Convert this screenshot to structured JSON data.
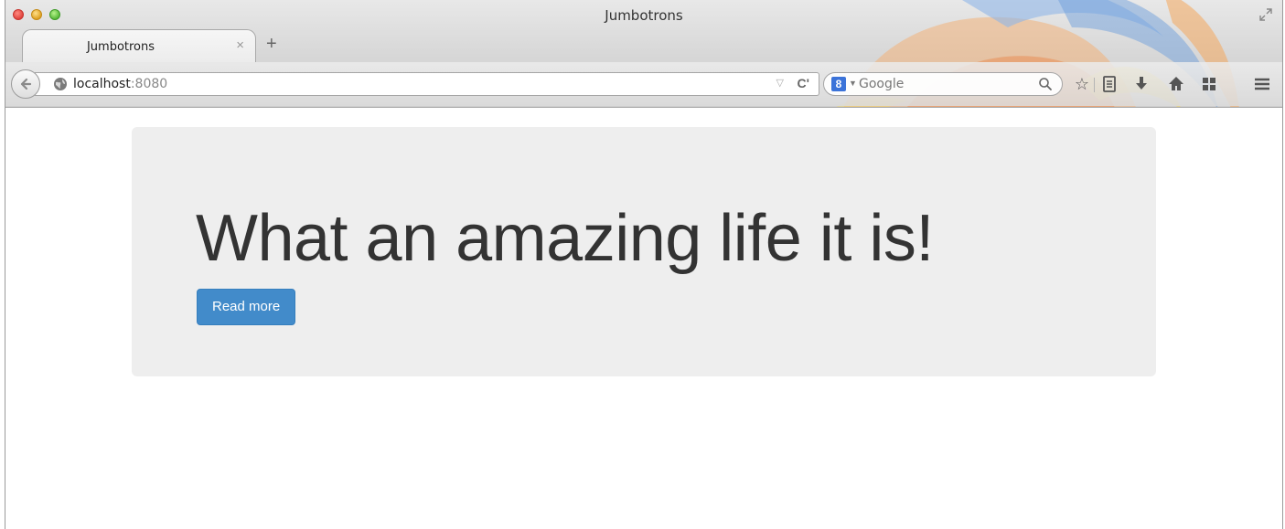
{
  "window": {
    "title": "Jumbotrons"
  },
  "tabs": [
    {
      "label": "Jumbotrons",
      "active": true
    }
  ],
  "toolbar": {
    "new_tab_label": "+",
    "tab_close_label": "×"
  },
  "address_bar": {
    "host": "localhost",
    "port": ":8080"
  },
  "search_bar": {
    "engine": "Google",
    "engine_icon_label": "8"
  },
  "toolbar_icons": [
    "star-icon",
    "reading-list-icon",
    "download-icon",
    "home-icon",
    "apps-icon",
    "menu-icon"
  ],
  "jumbotron": {
    "heading": "What an amazing life it is!",
    "button_label": "Read more"
  },
  "colors": {
    "jumbotron_bg": "#eeeeee",
    "heading_text": "#333333",
    "button_bg": "#428bca",
    "button_text": "#ffffff"
  }
}
